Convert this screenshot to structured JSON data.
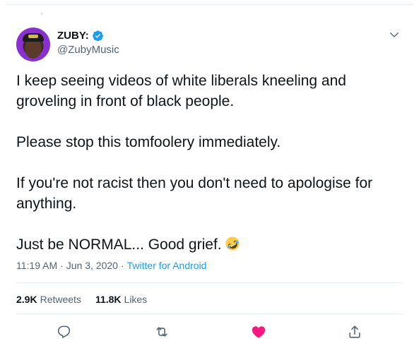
{
  "author": {
    "name": "ZUBY:",
    "handle": "@ZubyMusic",
    "verified": true
  },
  "tweet": {
    "paragraphs": [
      "I keep seeing videos of white liberals kneeling and groveling in front of black people.",
      "Please stop this tomfoolery immediately.",
      "If you're not racist then you don't need to apologise for anything.",
      "Just be NORMAL... Good grief."
    ],
    "emoji": "rolling-on-the-floor-laughing"
  },
  "meta": {
    "time": "11:19 AM",
    "separator": "·",
    "date": "Jun 3, 2020",
    "source": "Twitter for Android"
  },
  "stats": {
    "retweets_count": "2.9K",
    "retweets_label": "Retweets",
    "likes_count": "11.8K",
    "likes_label": "Likes"
  },
  "actions": {
    "reply_icon": "reply-icon",
    "retweet_icon": "retweet-icon",
    "like_icon": "heart-icon",
    "share_icon": "share-icon",
    "liked": true
  },
  "colors": {
    "accent": "#1d9bf0",
    "like": "#f91880",
    "text": "#0f1419",
    "secondary": "#536471",
    "divider": "#e6ecf0"
  }
}
